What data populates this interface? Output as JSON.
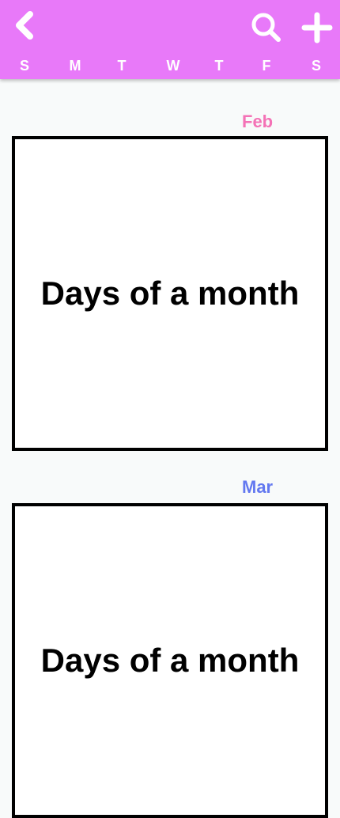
{
  "header": {
    "background": "#e879f9",
    "icons": {
      "back": "chevron-left-icon",
      "search": "search-icon",
      "add": "plus-icon"
    },
    "weekdays": [
      "S",
      "M",
      "T",
      "W",
      "T",
      "F",
      "S"
    ]
  },
  "months": [
    {
      "label": "Feb",
      "color": "#f472b6",
      "content": "Days of a month"
    },
    {
      "label": "Mar",
      "color": "#6378f0",
      "content": "Days of a month"
    }
  ]
}
